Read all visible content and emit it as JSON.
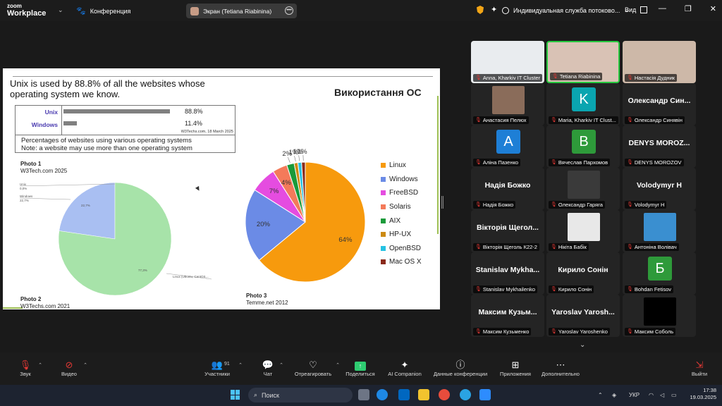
{
  "app": {
    "logo_line1": "zoom",
    "logo_line2": "Workplace",
    "meeting_label": "Конференция",
    "screen_share_label": "Экран (Tetiana Riabinina)",
    "service_label": "Индивидуальная служба потоково...",
    "view_label": "Вид",
    "window_buttons": [
      "—",
      "❐",
      "✕"
    ]
  },
  "slide": {
    "title": "Unix is used by 88.8% of all the websites whose operating system we know.",
    "heading": "Використання ОС",
    "w3box": {
      "rows": [
        {
          "label": "Unix",
          "value": 88.8,
          "display": "88.8%"
        },
        {
          "label": "Windows",
          "value": 11.4,
          "display": "11.4%"
        }
      ],
      "credit": "W3Techs.com, 18 March 2025"
    },
    "note_line1": "Percentages of websites using various operating systems",
    "note_line2": "Note: a website may use more than one operating system",
    "photo1_title": "Photo 1",
    "photo1_source": "W3Tech.com 2025",
    "photo2_title": "Photo 2",
    "photo2_source": "W3Techs.com 2021",
    "photo3_title": "Photo 3",
    "photo3_source": "Temme.net 2012",
    "pie2_labels": {
      "unix": "Unix",
      "unix_pct": "0,0%",
      "windows": "Windows",
      "windows_pct": "22,7%",
      "slice_windows": "22,7%",
      "slice_linux": "77,3%",
      "linux": "Linux (Ubuntu, CentOS,..."
    }
  },
  "chart_data": [
    {
      "type": "pie",
      "categories": [
        "Unix",
        "Windows",
        "Linux (Ubuntu, CentOS,..."
      ],
      "values": [
        0.0,
        22.7,
        77.3
      ],
      "colors": [
        "#7f7f7f",
        "#a9bff2",
        "#a7e3a9"
      ]
    },
    {
      "type": "pie",
      "categories": [
        "Linux",
        "Windows",
        "FreeBSD",
        "Solaris",
        "AIX",
        "HP-UX",
        "OpenBSD",
        "Mac OS X"
      ],
      "values": [
        64,
        20,
        7,
        4,
        2,
        1,
        1,
        1
      ],
      "labels": [
        "64%",
        "20%",
        "7%",
        "4%",
        "2%",
        "1%",
        "1%",
        "1%"
      ],
      "colors": [
        "#f79a0d",
        "#6b8be6",
        "#e54ce0",
        "#f47a5a",
        "#1a9a3a",
        "#cc8a12",
        "#25c2e3",
        "#8a2a1a"
      ],
      "legend": "right"
    }
  ],
  "participants": [
    {
      "name": "Anna, Kharkiv IT Cluster",
      "kind": "video",
      "color": "#e9ecef"
    },
    {
      "name": "Tetiana Riabinina",
      "kind": "video-active",
      "color": "#d9c2b5"
    },
    {
      "name": "Настасія Дудник",
      "kind": "video",
      "color": "#cdb8a8"
    },
    {
      "name": "Анастасия Пелюх",
      "kind": "photo",
      "color": "#8a6c5a"
    },
    {
      "name": "Maria, Kharkiv IT Clust...",
      "kind": "avatar",
      "letter": "K",
      "color": "#0aa5b0"
    },
    {
      "name": "Олександр Синявін",
      "kind": "text",
      "big": "Олександр Син..."
    },
    {
      "name": "Аліна Пазенко",
      "kind": "avatar",
      "letter": "A",
      "color": "#1e7fd6"
    },
    {
      "name": "Вячеслав Пархомов",
      "kind": "avatar",
      "letter": "B",
      "color": "#2e9a3a"
    },
    {
      "name": "DENYS MOROZOV",
      "kind": "text",
      "big": "DENYS MOROZ..."
    },
    {
      "name": "Надія Божко",
      "kind": "text",
      "big": "Надія Божко"
    },
    {
      "name": "Олександр Гаряга",
      "kind": "photo",
      "color": "#3a3a3a"
    },
    {
      "name": "Volodymyr H",
      "kind": "text",
      "big": "Volodymyr H"
    },
    {
      "name": "Вікторія Щеголь К22-2",
      "kind": "text",
      "big": "Вікторія Щегол..."
    },
    {
      "name": "Нікіта Бабік",
      "kind": "photo",
      "color": "#e8e8e8"
    },
    {
      "name": "Антоніна Волівач",
      "kind": "photo",
      "color": "#3a8fd0"
    },
    {
      "name": "Stanislav Mykhailenko",
      "kind": "text",
      "big": "Stanislav Mykha..."
    },
    {
      "name": "Кирило Сонін",
      "kind": "text",
      "big": "Кирило Сонін"
    },
    {
      "name": "Bohdan Fetisov",
      "kind": "avatar",
      "letter": "Б",
      "color": "#2e9a3a"
    },
    {
      "name": "Максим Кузьменко",
      "kind": "text",
      "big": "Максим Кузьм..."
    },
    {
      "name": "Yaroslav Yaroshenko",
      "kind": "text",
      "big": "Yaroslav Yarosh..."
    },
    {
      "name": "Максим Соболь",
      "kind": "photo",
      "color": "#000000"
    }
  ],
  "toolbar": {
    "audio": "Звук",
    "video": "Видео",
    "participants": "Участники",
    "participants_count": "91",
    "chat": "Чат",
    "react": "Отреагировать",
    "share": "Поделиться",
    "ai": "AI Companion",
    "info": "Данные конференции",
    "apps": "Приложения",
    "more": "Дополнительно",
    "leave": "Выйти"
  },
  "taskbar": {
    "search_placeholder": "Поиск",
    "lang": "УКР",
    "time": "17:38",
    "date": "19.03.2025"
  }
}
